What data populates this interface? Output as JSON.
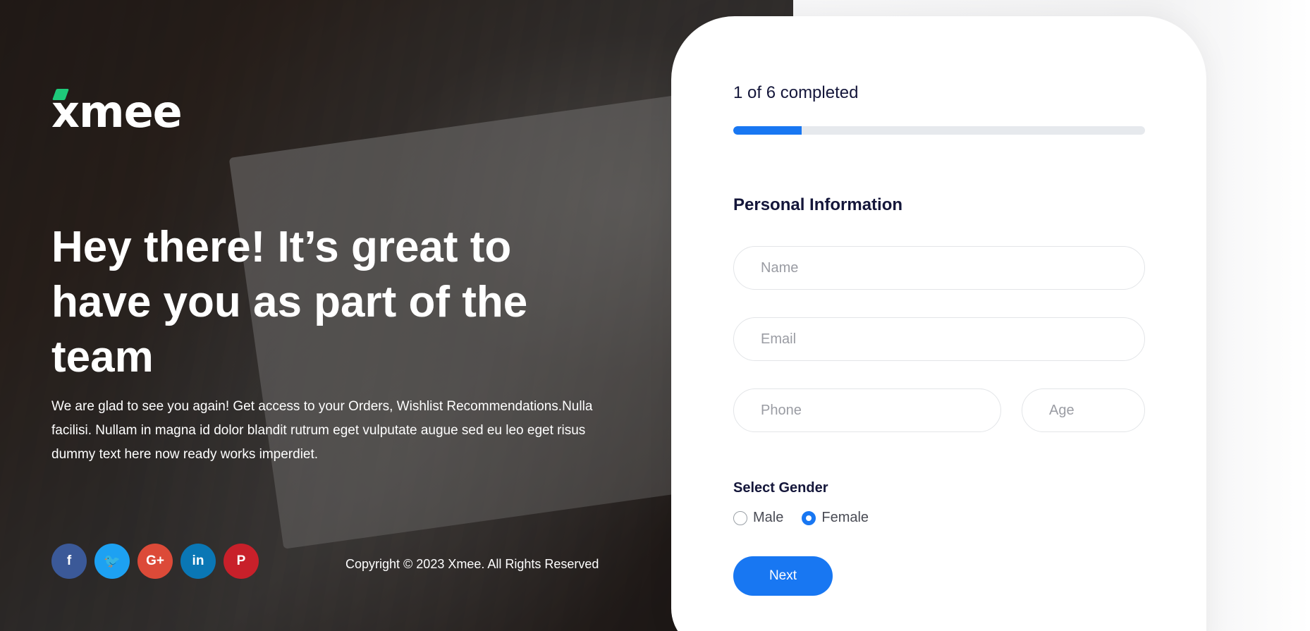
{
  "brand": {
    "logo_text_x": "x",
    "logo_text_rest": "mee"
  },
  "hero": {
    "headline": "Hey there! It’s great to have you as part of the team",
    "intro": "We are glad to see you again! Get access to your Orders, Wishlist Recommendations.Nulla facilisi. Nullam in magna id dolor blandit rutrum eget vulputate augue sed eu leo eget risus dummy text here now ready works imperdiet.",
    "copyright": "Copyright © 2023 Xmee. All Rights Reserved"
  },
  "socials": [
    {
      "icon": "facebook-icon",
      "glyph": "f",
      "color": "#3b5998"
    },
    {
      "icon": "twitter-icon",
      "glyph": "🐦",
      "color": "#1da1f2"
    },
    {
      "icon": "google-plus-icon",
      "glyph": "G+",
      "color": "#dc4a38"
    },
    {
      "icon": "linkedin-icon",
      "glyph": "in",
      "color": "#0a77b5"
    },
    {
      "icon": "pinterest-icon",
      "glyph": "P",
      "color": "#c8202a"
    }
  ],
  "form": {
    "progress_text": "1 of 6 completed",
    "progress_fraction": 0.1667,
    "progress_color": "#1877f2",
    "section_title": "Personal Information",
    "name_placeholder": "Name",
    "email_placeholder": "Email",
    "phone_placeholder": "Phone",
    "age_placeholder": "Age",
    "gender_label": "Select Gender",
    "gender_options": [
      {
        "label": "Male",
        "checked": false
      },
      {
        "label": "Female",
        "checked": true
      }
    ],
    "next_label": "Next"
  }
}
